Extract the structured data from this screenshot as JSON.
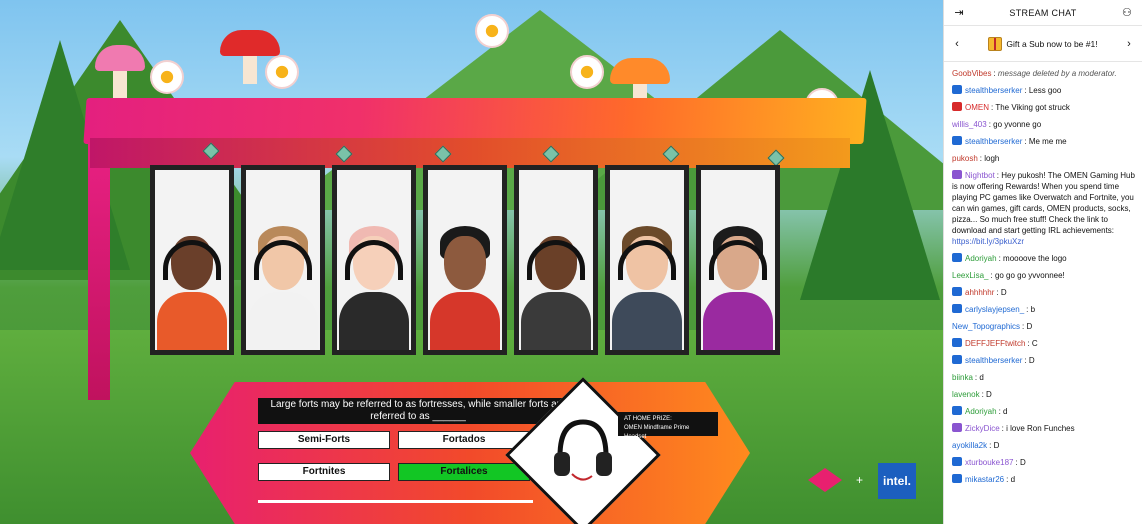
{
  "video": {
    "question": "Large forts may be referred to as fortresses, while smaller forts are referred to as ______",
    "answers": [
      "Semi-Forts",
      "Fortados",
      "Fortnites",
      "Fortalices"
    ],
    "prize_label": "AT HOME PRIZE:",
    "prize_name": "OMEN Mindframe Prime Headset",
    "omen_logo": "OMEN",
    "plus": "+",
    "intel_logo": "intel.",
    "colors": {
      "roof_start": "#e4207f",
      "roof_end": "#ffb020",
      "correct_answer": "#12c624"
    }
  },
  "chat": {
    "header_title": "STREAM CHAT",
    "collapse_icon": "collapse-arrow-icon",
    "users_icon": "users-icon",
    "sub_banner": {
      "text": "Gift a Sub now to be #1!",
      "prev_icon": "chevron-left-icon",
      "next_icon": "chevron-right-icon"
    },
    "messages": [
      {
        "name": "GoobVibes",
        "text": "message deleted by a moderator.",
        "color": "#c0392b",
        "badge": "",
        "deleted": true
      },
      {
        "name": "stealthberserker",
        "text": "Less goo",
        "color": "#1f69d3",
        "badge": "sub"
      },
      {
        "name": "OMEN",
        "text": "The Viking got struck",
        "color": "#d72a2a",
        "badge": "omen"
      },
      {
        "name": "willis_403",
        "text": "go yvonne go",
        "color": "#8a55d0",
        "badge": ""
      },
      {
        "name": "stealthberserker",
        "text": "Me me me",
        "color": "#1f69d3",
        "badge": "sub"
      },
      {
        "name": "pukosh",
        "text": "logh",
        "color": "#c0392b",
        "badge": ""
      },
      {
        "name": "Nightbot",
        "text": "Hey pukosh! The OMEN Gaming Hub is now offering Rewards! When you spend time playing PC games like Overwatch and Fortnite, you can win games, gift cards, OMEN products, socks, pizza... So much free stuff! Check the link to download and start getting IRL achievements:",
        "link": "https://bit.ly/3pkuXzr",
        "color": "#8a55d0",
        "badge": "bot"
      },
      {
        "name": "Adoriyah",
        "text": "moooove the logo",
        "color": "#2e9d3a",
        "badge": "sub"
      },
      {
        "name": "LeexLisa_",
        "text": "go go go yvvonnee!",
        "color": "#2e9d3a",
        "badge": ""
      },
      {
        "name": "ahhhhhr",
        "text": "D",
        "color": "#c0392b",
        "badge": "sub"
      },
      {
        "name": "carlyslayjepsen_",
        "text": "b",
        "color": "#1f69d3",
        "badge": "sub"
      },
      {
        "name": "New_Topographics",
        "text": "D",
        "color": "#1f69d3",
        "badge": ""
      },
      {
        "name": "DEFFJEFFtwitch",
        "text": "C",
        "color": "#c0392b",
        "badge": "sub"
      },
      {
        "name": "stealthberserker",
        "text": "D",
        "color": "#1f69d3",
        "badge": "sub"
      },
      {
        "name": "biinka",
        "text": "d",
        "color": "#2e9d3a",
        "badge": ""
      },
      {
        "name": "lavenok",
        "text": "D",
        "color": "#2e9d3a",
        "badge": ""
      },
      {
        "name": "Adoriyah",
        "text": "d",
        "color": "#2e9d3a",
        "badge": "sub"
      },
      {
        "name": "ZickyDice",
        "text": "i love Ron Funches",
        "color": "#8a55d0",
        "badge": "bot"
      },
      {
        "name": "ayokilla2k",
        "text": "D",
        "color": "#1f69d3",
        "badge": ""
      },
      {
        "name": "xturbouke187",
        "text": "D",
        "color": "#8a55d0",
        "badge": "sub"
      },
      {
        "name": "mikastar26",
        "text": "d",
        "color": "#1f69d3",
        "badge": "sub"
      }
    ]
  }
}
